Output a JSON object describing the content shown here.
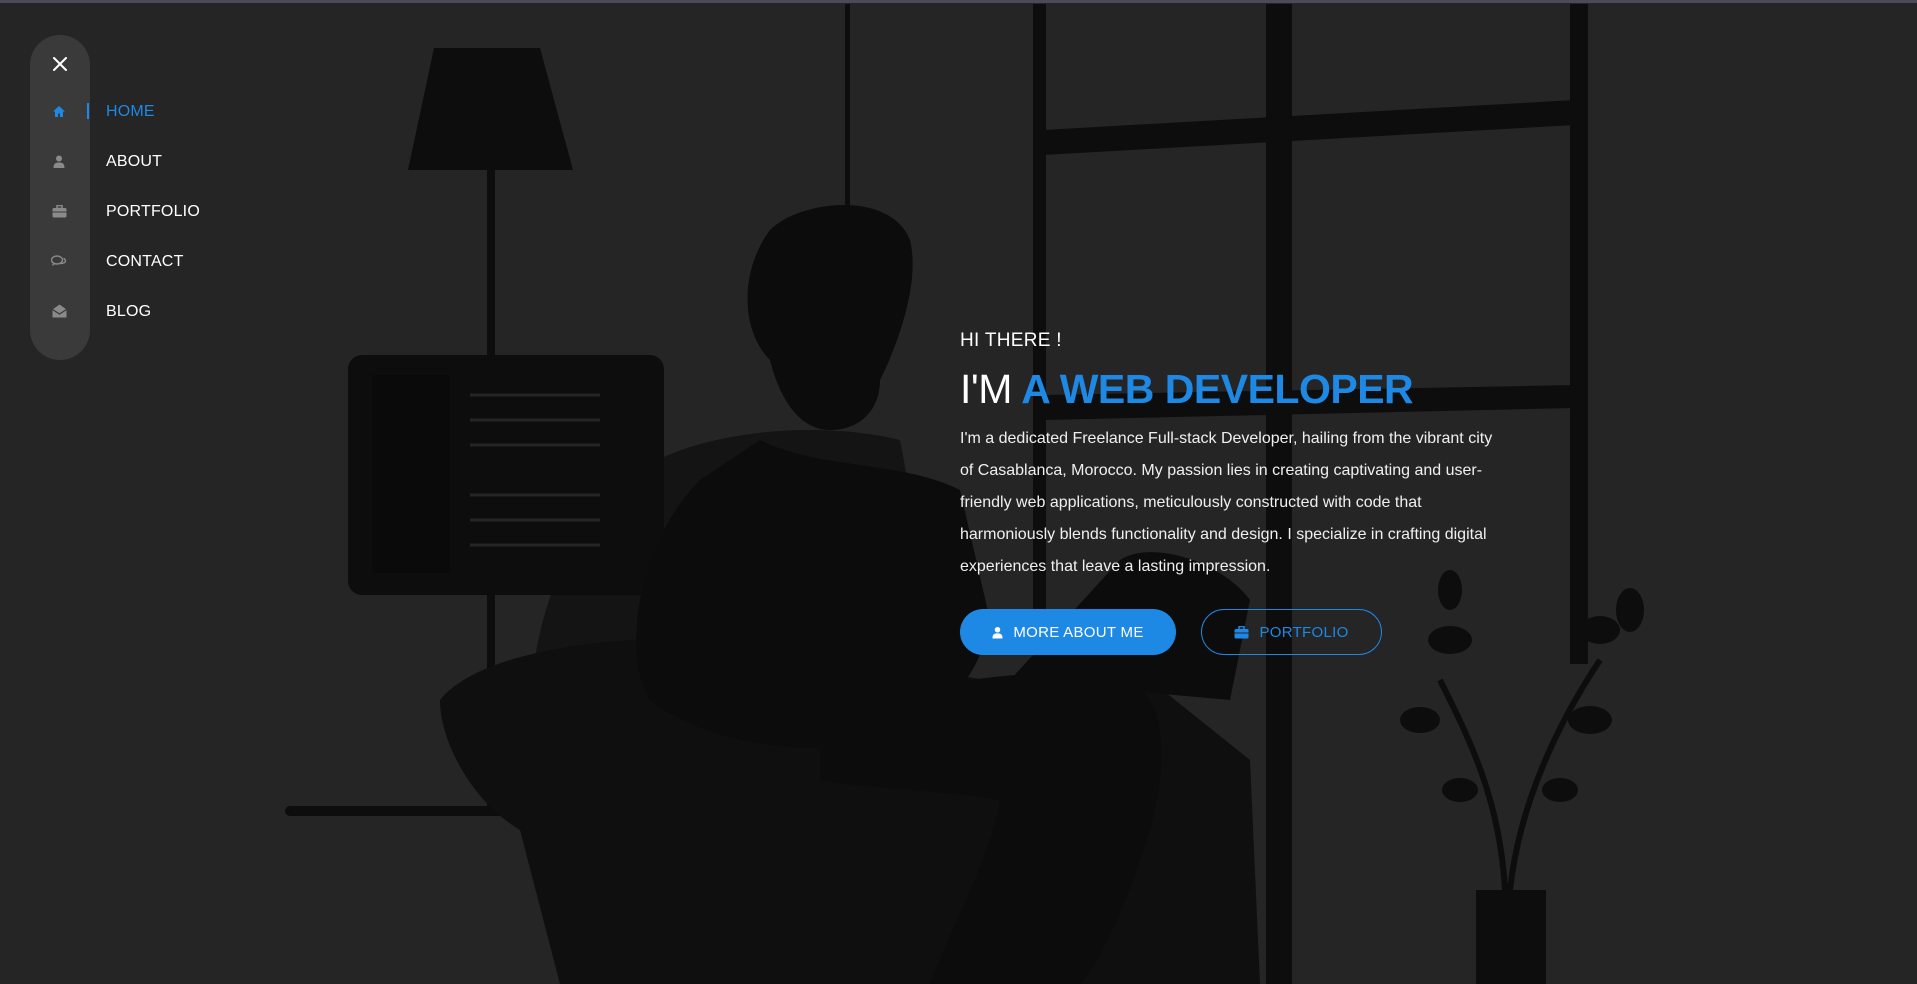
{
  "sidebar": {
    "close_icon": "close-icon",
    "items": [
      {
        "label": "HOME",
        "icon": "home-icon",
        "active": true
      },
      {
        "label": "ABOUT",
        "icon": "user-icon",
        "active": false
      },
      {
        "label": "PORTFOLIO",
        "icon": "briefcase-icon",
        "active": false
      },
      {
        "label": "CONTACT",
        "icon": "chat-icon",
        "active": false
      },
      {
        "label": "BLOG",
        "icon": "envelope-open-icon",
        "active": false
      }
    ]
  },
  "hero": {
    "greeting": "HI THERE !",
    "headline_prefix": "I'M",
    "headline_accent": "A WEB DEVELOPER",
    "description": "I'm a dedicated Freelance Full-stack Developer, hailing from the vibrant city of Casablanca, Morocco. My passion lies in creating captivating and user-friendly web applications, meticulously constructed with code that harmoniously blends functionality and design. I specialize in crafting digital experiences that leave a lasting impression.",
    "primary_button": {
      "label": "MORE ABOUT ME",
      "icon": "user-icon"
    },
    "secondary_button": {
      "label": "PORTFOLIO",
      "icon": "briefcase-icon"
    }
  },
  "colors": {
    "background": "#252525",
    "accent": "#1e88e5",
    "sidebar": "#3a3a3a"
  }
}
